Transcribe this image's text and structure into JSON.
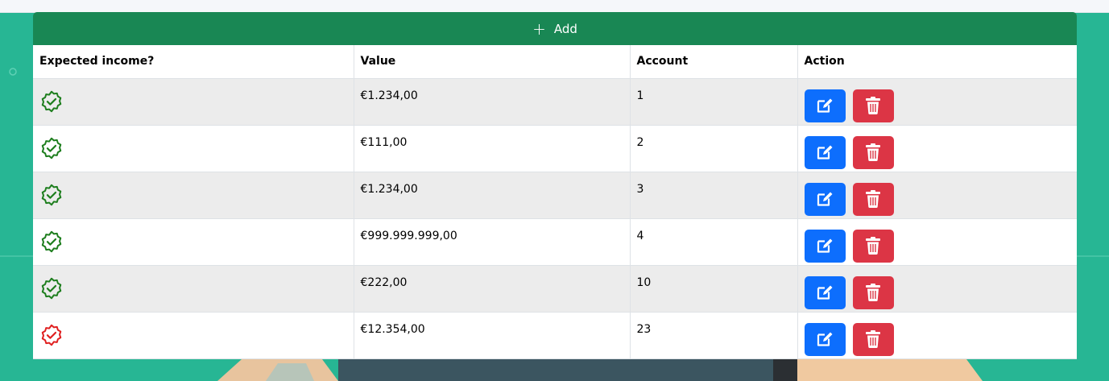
{
  "add_button": {
    "label": "Add",
    "icon": "plus-icon"
  },
  "table": {
    "headers": {
      "expected_income": "Expected income?",
      "value": "Value",
      "account": "Account",
      "action": "Action"
    },
    "rows": [
      {
        "expected": true,
        "value": "€1.234,00",
        "account": "1"
      },
      {
        "expected": true,
        "value": "€111,00",
        "account": "2"
      },
      {
        "expected": true,
        "value": "€1.234,00",
        "account": "3"
      },
      {
        "expected": true,
        "value": "€999.999.999,00",
        "account": "4"
      },
      {
        "expected": true,
        "value": "€222,00",
        "account": "10"
      },
      {
        "expected": false,
        "value": "€12.354,00",
        "account": "23"
      }
    ]
  },
  "colors": {
    "add_green": "#198754",
    "check_green": "#1e7e1e",
    "check_red": "#e02020",
    "edit_blue": "#0d6efd",
    "delete_red": "#dc3545",
    "background": "#27b694"
  }
}
